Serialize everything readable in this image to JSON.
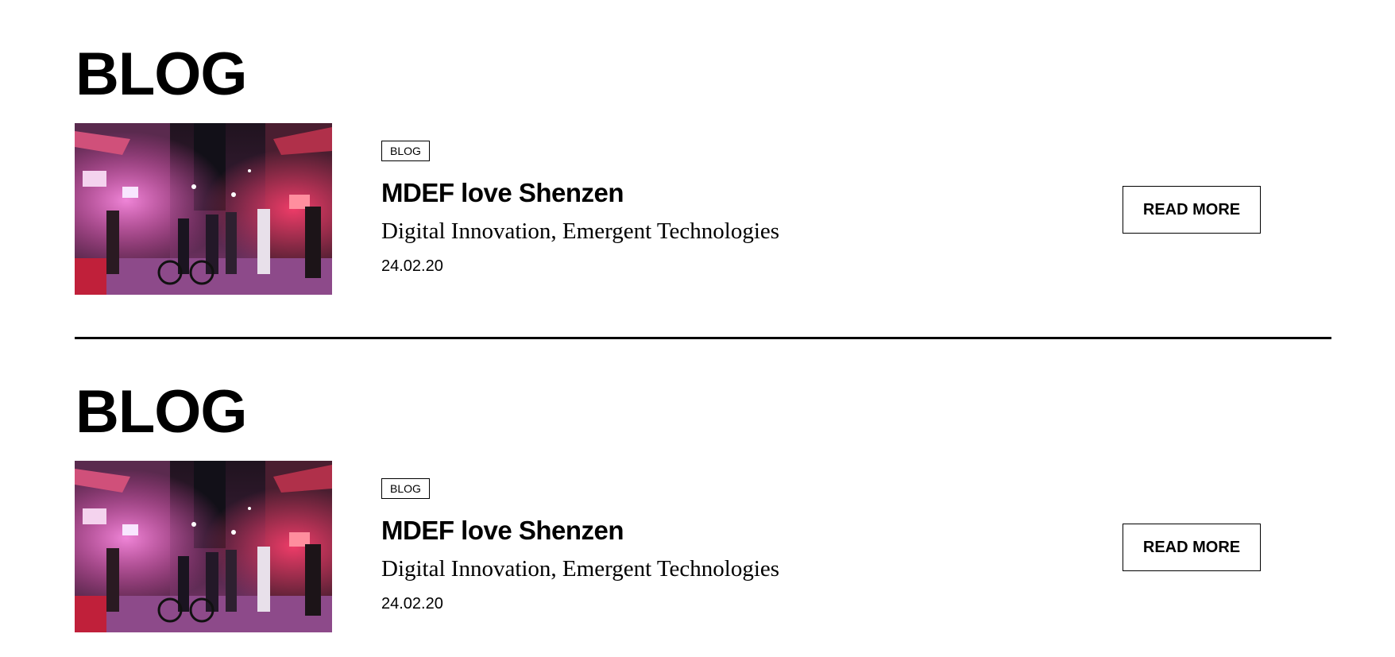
{
  "sections": [
    {
      "title": "BLOG",
      "post": {
        "tag": "BLOG",
        "title": "MDEF love Shenzen",
        "categories": "Digital Innovation, Emergent Technologies",
        "date": "24.02.20",
        "cta": "READ MORE"
      }
    },
    {
      "title": "BLOG",
      "post": {
        "tag": "BLOG",
        "title": "MDEF love Shenzen",
        "categories": "Digital Innovation, Emergent Technologies",
        "date": "24.02.20",
        "cta": "READ MORE"
      }
    }
  ]
}
